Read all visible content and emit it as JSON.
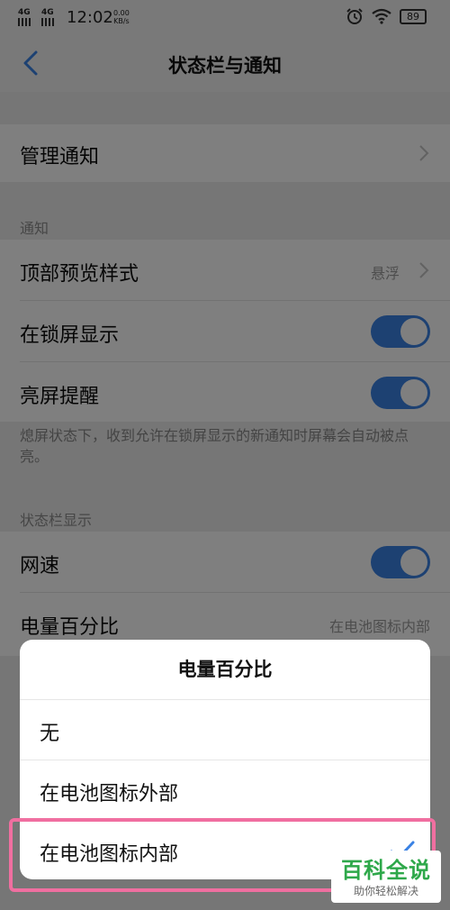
{
  "status_bar": {
    "sim1": "4G",
    "sim2": "4G",
    "time": "12:02",
    "speed_value": "0.00",
    "speed_unit": "KB/s",
    "battery": "89"
  },
  "header": {
    "title": "状态栏与通知"
  },
  "settings": {
    "manage_notifications": "管理通知",
    "section_notifications": "通知",
    "top_preview_style": {
      "label": "顶部预览样式",
      "value": "悬浮"
    },
    "show_on_lockscreen": {
      "label": "在锁屏显示",
      "enabled": true
    },
    "wake_screen": {
      "label": "亮屏提醒",
      "enabled": true
    },
    "wake_screen_desc": "熄屏状态下，收到允许在锁屏显示的新通知时屏幕会自动被点亮。",
    "section_statusbar": "状态栏显示",
    "network_speed": {
      "label": "网速",
      "enabled": true
    },
    "battery_percentage": {
      "label": "电量百分比",
      "value": "在电池图标内部"
    }
  },
  "dialog": {
    "title": "电量百分比",
    "options": [
      "无",
      "在电池图标外部",
      "在电池图标内部"
    ],
    "selected_index": 2
  },
  "watermark": {
    "brand": "百科全说",
    "slogan": "助你轻松解决"
  },
  "colors": {
    "accent": "#3a82e4",
    "highlight": "#f06fa0",
    "watermark": "#2ea84a"
  }
}
